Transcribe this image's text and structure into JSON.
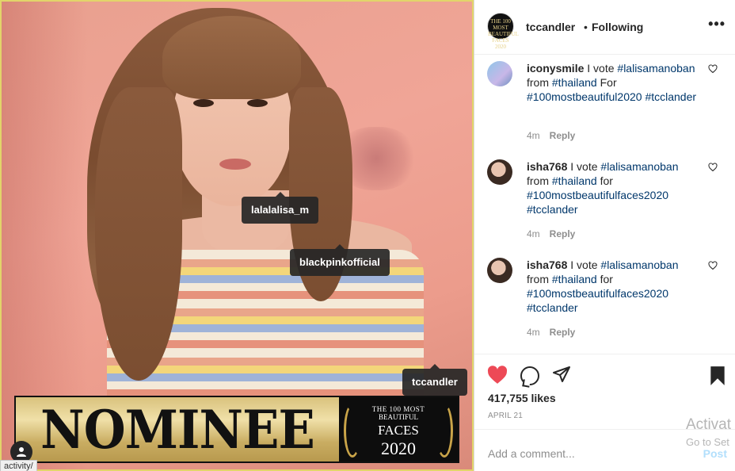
{
  "photo": {
    "tags": [
      "lalalalisa_m",
      "blackpinkofficial",
      "tccandler"
    ],
    "banner": {
      "word": "NOMINEE",
      "badge_line1": "THE 100 MOST",
      "badge_line2": "BEAUTIFUL",
      "badge_line3": "FACES",
      "badge_line4": "2020"
    },
    "status_url": "activity/"
  },
  "header": {
    "username": "tccandler",
    "separator": "•",
    "follow_status": "Following",
    "more_icon": "more-dots-icon",
    "more_label": "•••",
    "avatar_text": "THE 100 MOST BEAUTIFUL FACES 2020"
  },
  "comments": [
    {
      "username": "iconysmile",
      "text_prefix": " I vote ",
      "tag1": "#lalisamanoban",
      "mid1": " from ",
      "tag2": "#thailand",
      "mid2": " For ",
      "tag3": "#100mostbeautiful2020",
      "mid3": " ",
      "tag4": "#tcclander",
      "time": "4m",
      "reply": "Reply"
    },
    {
      "username": "isha768",
      "text_prefix": " I vote ",
      "tag1": "#lalisamanoban",
      "mid1": " from ",
      "tag2": "#thailand",
      "mid2": " for ",
      "tag3": "#100mostbeautifulfaces2020",
      "mid3": " ",
      "tag4": "#tcclander",
      "time": "4m",
      "reply": "Reply"
    },
    {
      "username": "isha768",
      "text_prefix": " I vote ",
      "tag1": "#lalisamanoban",
      "mid1": " from ",
      "tag2": "#thailand",
      "mid2": " for ",
      "tag3": "#100mostbeautifulfaces2020",
      "mid3": " ",
      "tag4": "#tcclander",
      "time": "4m",
      "reply": "Reply"
    }
  ],
  "actions": {
    "like_icon": "heart-filled-icon",
    "comment_icon": "comment-bubble-icon",
    "share_icon": "paper-plane-icon",
    "save_icon": "bookmark-filled-icon",
    "likes": "417,755 likes",
    "date": "APRIL 21",
    "add_comment_placeholder": "Add a comment...",
    "post_label": "Post"
  },
  "windows_watermark": {
    "line1": "Activat",
    "line2": "Go to Set"
  },
  "colors": {
    "like_red": "#ed4956",
    "hashtag": "#00376b",
    "post_disabled": "#b2dffc"
  }
}
